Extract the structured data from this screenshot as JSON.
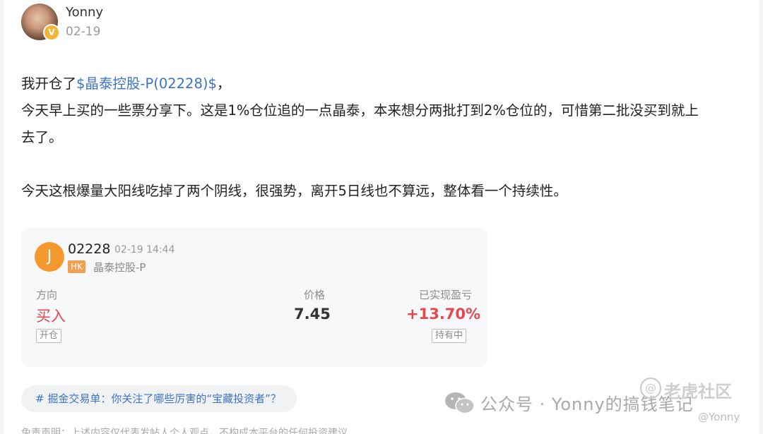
{
  "author": {
    "name": "Yonny",
    "date": "02-19",
    "verified_badge": "V"
  },
  "post": {
    "line1_prefix": "我开仓了",
    "stock_link": "$晶泰控股-P(02228)$",
    "line1_suffix": "，",
    "line2": "今天早上买的一些票分享下。这是1%仓位追的一点晶泰，本来想分两批打到2%仓位的，可惜第二批没买到就上",
    "line3": "去了。",
    "line4": "今天这根爆量大阳线吃掉了两个阴线，很强势，离开5日线也不算远，整体看一个持续性。"
  },
  "trade_card": {
    "avatar_letter": "J",
    "code": "02228",
    "time": "02-19 14:44",
    "market": "HK",
    "name": "晶泰控股-P",
    "direction_label": "方向",
    "price_label": "价格",
    "pnl_label": "已实现盈亏",
    "direction": "买入",
    "price": "7.45",
    "pnl": "+13.70%",
    "open_tag": "开仓",
    "hold_tag": "持有中",
    "colors": {
      "up": "#e5484d",
      "market_badge": "#f0a050",
      "avatar": "#f39a2e"
    }
  },
  "topic": "# 掘金交易单：你关注了哪些厉害的“宝藏投资者”？",
  "watermark": {
    "account": "公众号 · Yonny的搞钱笔记",
    "community": "老虎社区",
    "handle": "@Yonny",
    "icon": "wechat-icon"
  },
  "disclaimer": "免责声明：上述内容仅代表发帖人个人观点，不构成本平台的任何投资建议"
}
